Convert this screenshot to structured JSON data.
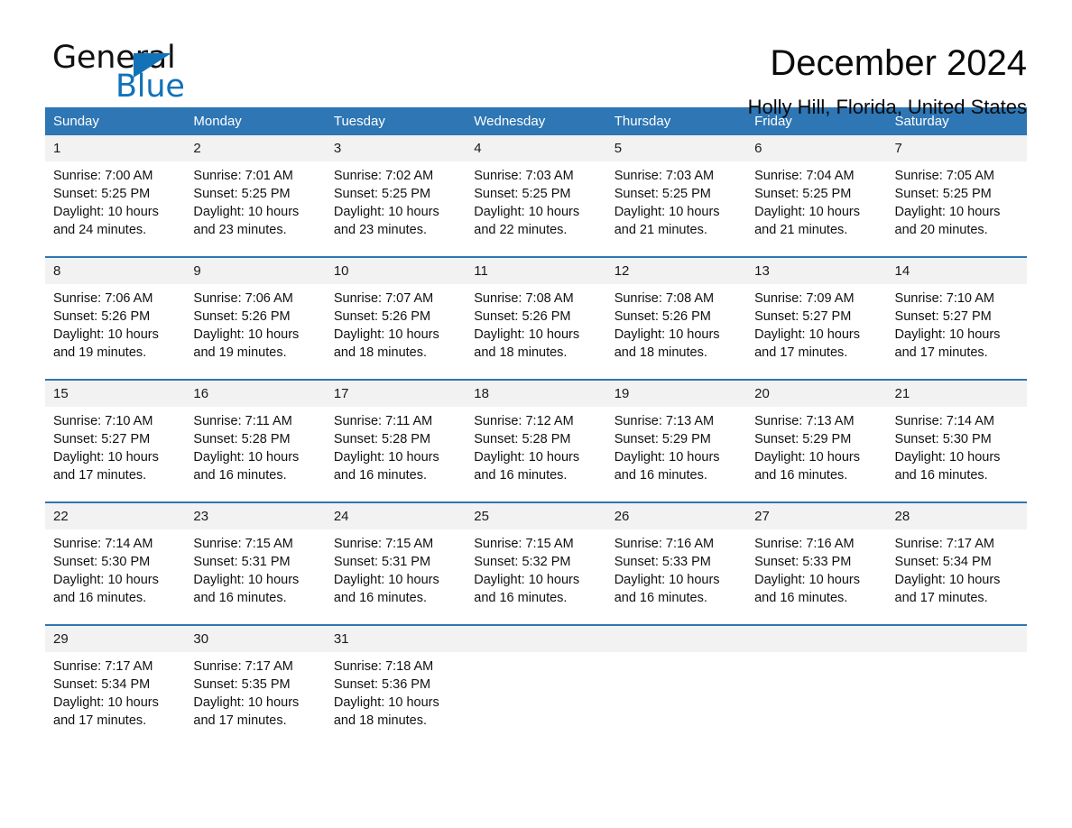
{
  "brand": {
    "name_part1": "General",
    "name_part2": "Blue",
    "triangle_icon": "triangle-icon",
    "accent_color": "#1272b8"
  },
  "header": {
    "title": "December 2024",
    "subtitle": "Holly Hill, Florida, United States"
  },
  "calendar": {
    "header_color": "#2e76b4",
    "daynum_band_color": "#f2f2f2",
    "weekday_headers": [
      "Sunday",
      "Monday",
      "Tuesday",
      "Wednesday",
      "Thursday",
      "Friday",
      "Saturday"
    ],
    "weeks": [
      [
        {
          "day": "1",
          "sunrise": "Sunrise: 7:00 AM",
          "sunset": "Sunset: 5:25 PM",
          "daylight_line1": "Daylight: 10 hours",
          "daylight_line2": "and 24 minutes."
        },
        {
          "day": "2",
          "sunrise": "Sunrise: 7:01 AM",
          "sunset": "Sunset: 5:25 PM",
          "daylight_line1": "Daylight: 10 hours",
          "daylight_line2": "and 23 minutes."
        },
        {
          "day": "3",
          "sunrise": "Sunrise: 7:02 AM",
          "sunset": "Sunset: 5:25 PM",
          "daylight_line1": "Daylight: 10 hours",
          "daylight_line2": "and 23 minutes."
        },
        {
          "day": "4",
          "sunrise": "Sunrise: 7:03 AM",
          "sunset": "Sunset: 5:25 PM",
          "daylight_line1": "Daylight: 10 hours",
          "daylight_line2": "and 22 minutes."
        },
        {
          "day": "5",
          "sunrise": "Sunrise: 7:03 AM",
          "sunset": "Sunset: 5:25 PM",
          "daylight_line1": "Daylight: 10 hours",
          "daylight_line2": "and 21 minutes."
        },
        {
          "day": "6",
          "sunrise": "Sunrise: 7:04 AM",
          "sunset": "Sunset: 5:25 PM",
          "daylight_line1": "Daylight: 10 hours",
          "daylight_line2": "and 21 minutes."
        },
        {
          "day": "7",
          "sunrise": "Sunrise: 7:05 AM",
          "sunset": "Sunset: 5:25 PM",
          "daylight_line1": "Daylight: 10 hours",
          "daylight_line2": "and 20 minutes."
        }
      ],
      [
        {
          "day": "8",
          "sunrise": "Sunrise: 7:06 AM",
          "sunset": "Sunset: 5:26 PM",
          "daylight_line1": "Daylight: 10 hours",
          "daylight_line2": "and 19 minutes."
        },
        {
          "day": "9",
          "sunrise": "Sunrise: 7:06 AM",
          "sunset": "Sunset: 5:26 PM",
          "daylight_line1": "Daylight: 10 hours",
          "daylight_line2": "and 19 minutes."
        },
        {
          "day": "10",
          "sunrise": "Sunrise: 7:07 AM",
          "sunset": "Sunset: 5:26 PM",
          "daylight_line1": "Daylight: 10 hours",
          "daylight_line2": "and 18 minutes."
        },
        {
          "day": "11",
          "sunrise": "Sunrise: 7:08 AM",
          "sunset": "Sunset: 5:26 PM",
          "daylight_line1": "Daylight: 10 hours",
          "daylight_line2": "and 18 minutes."
        },
        {
          "day": "12",
          "sunrise": "Sunrise: 7:08 AM",
          "sunset": "Sunset: 5:26 PM",
          "daylight_line1": "Daylight: 10 hours",
          "daylight_line2": "and 18 minutes."
        },
        {
          "day": "13",
          "sunrise": "Sunrise: 7:09 AM",
          "sunset": "Sunset: 5:27 PM",
          "daylight_line1": "Daylight: 10 hours",
          "daylight_line2": "and 17 minutes."
        },
        {
          "day": "14",
          "sunrise": "Sunrise: 7:10 AM",
          "sunset": "Sunset: 5:27 PM",
          "daylight_line1": "Daylight: 10 hours",
          "daylight_line2": "and 17 minutes."
        }
      ],
      [
        {
          "day": "15",
          "sunrise": "Sunrise: 7:10 AM",
          "sunset": "Sunset: 5:27 PM",
          "daylight_line1": "Daylight: 10 hours",
          "daylight_line2": "and 17 minutes."
        },
        {
          "day": "16",
          "sunrise": "Sunrise: 7:11 AM",
          "sunset": "Sunset: 5:28 PM",
          "daylight_line1": "Daylight: 10 hours",
          "daylight_line2": "and 16 minutes."
        },
        {
          "day": "17",
          "sunrise": "Sunrise: 7:11 AM",
          "sunset": "Sunset: 5:28 PM",
          "daylight_line1": "Daylight: 10 hours",
          "daylight_line2": "and 16 minutes."
        },
        {
          "day": "18",
          "sunrise": "Sunrise: 7:12 AM",
          "sunset": "Sunset: 5:28 PM",
          "daylight_line1": "Daylight: 10 hours",
          "daylight_line2": "and 16 minutes."
        },
        {
          "day": "19",
          "sunrise": "Sunrise: 7:13 AM",
          "sunset": "Sunset: 5:29 PM",
          "daylight_line1": "Daylight: 10 hours",
          "daylight_line2": "and 16 minutes."
        },
        {
          "day": "20",
          "sunrise": "Sunrise: 7:13 AM",
          "sunset": "Sunset: 5:29 PM",
          "daylight_line1": "Daylight: 10 hours",
          "daylight_line2": "and 16 minutes."
        },
        {
          "day": "21",
          "sunrise": "Sunrise: 7:14 AM",
          "sunset": "Sunset: 5:30 PM",
          "daylight_line1": "Daylight: 10 hours",
          "daylight_line2": "and 16 minutes."
        }
      ],
      [
        {
          "day": "22",
          "sunrise": "Sunrise: 7:14 AM",
          "sunset": "Sunset: 5:30 PM",
          "daylight_line1": "Daylight: 10 hours",
          "daylight_line2": "and 16 minutes."
        },
        {
          "day": "23",
          "sunrise": "Sunrise: 7:15 AM",
          "sunset": "Sunset: 5:31 PM",
          "daylight_line1": "Daylight: 10 hours",
          "daylight_line2": "and 16 minutes."
        },
        {
          "day": "24",
          "sunrise": "Sunrise: 7:15 AM",
          "sunset": "Sunset: 5:31 PM",
          "daylight_line1": "Daylight: 10 hours",
          "daylight_line2": "and 16 minutes."
        },
        {
          "day": "25",
          "sunrise": "Sunrise: 7:15 AM",
          "sunset": "Sunset: 5:32 PM",
          "daylight_line1": "Daylight: 10 hours",
          "daylight_line2": "and 16 minutes."
        },
        {
          "day": "26",
          "sunrise": "Sunrise: 7:16 AM",
          "sunset": "Sunset: 5:33 PM",
          "daylight_line1": "Daylight: 10 hours",
          "daylight_line2": "and 16 minutes."
        },
        {
          "day": "27",
          "sunrise": "Sunrise: 7:16 AM",
          "sunset": "Sunset: 5:33 PM",
          "daylight_line1": "Daylight: 10 hours",
          "daylight_line2": "and 16 minutes."
        },
        {
          "day": "28",
          "sunrise": "Sunrise: 7:17 AM",
          "sunset": "Sunset: 5:34 PM",
          "daylight_line1": "Daylight: 10 hours",
          "daylight_line2": "and 17 minutes."
        }
      ],
      [
        {
          "day": "29",
          "sunrise": "Sunrise: 7:17 AM",
          "sunset": "Sunset: 5:34 PM",
          "daylight_line1": "Daylight: 10 hours",
          "daylight_line2": "and 17 minutes."
        },
        {
          "day": "30",
          "sunrise": "Sunrise: 7:17 AM",
          "sunset": "Sunset: 5:35 PM",
          "daylight_line1": "Daylight: 10 hours",
          "daylight_line2": "and 17 minutes."
        },
        {
          "day": "31",
          "sunrise": "Sunrise: 7:18 AM",
          "sunset": "Sunset: 5:36 PM",
          "daylight_line1": "Daylight: 10 hours",
          "daylight_line2": "and 18 minutes."
        },
        {
          "day": "",
          "sunrise": "",
          "sunset": "",
          "daylight_line1": "",
          "daylight_line2": ""
        },
        {
          "day": "",
          "sunrise": "",
          "sunset": "",
          "daylight_line1": "",
          "daylight_line2": ""
        },
        {
          "day": "",
          "sunrise": "",
          "sunset": "",
          "daylight_line1": "",
          "daylight_line2": ""
        },
        {
          "day": "",
          "sunrise": "",
          "sunset": "",
          "daylight_line1": "",
          "daylight_line2": ""
        }
      ]
    ]
  }
}
